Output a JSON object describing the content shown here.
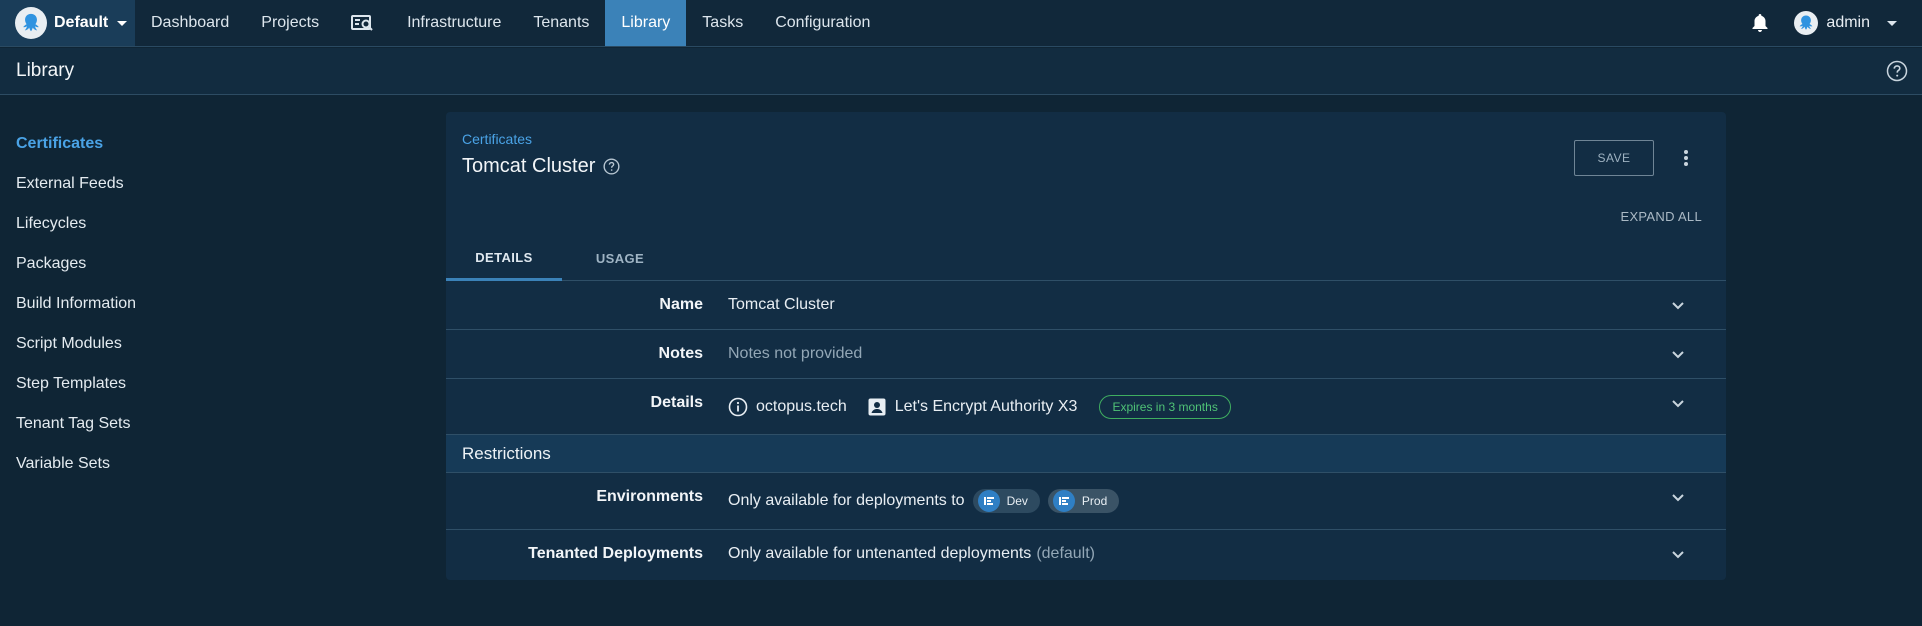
{
  "nav": {
    "space": "Default",
    "items": [
      "Dashboard",
      "Projects",
      "Infrastructure",
      "Tenants",
      "Library",
      "Tasks",
      "Configuration"
    ],
    "active": "Library",
    "user": "admin"
  },
  "page": {
    "title": "Library"
  },
  "sidebar": {
    "items": [
      "Certificates",
      "External Feeds",
      "Lifecycles",
      "Packages",
      "Build Information",
      "Script Modules",
      "Step Templates",
      "Tenant Tag Sets",
      "Variable Sets"
    ],
    "active": "Certificates"
  },
  "card": {
    "breadcrumb": "Certificates",
    "title": "Tomcat Cluster",
    "save_label": "SAVE",
    "expand_all": "EXPAND ALL",
    "tabs": [
      "DETAILS",
      "USAGE"
    ],
    "active_tab": "DETAILS",
    "rows": {
      "name": {
        "label": "Name",
        "value": "Tomcat Cluster"
      },
      "notes": {
        "label": "Notes",
        "value": "Notes not provided"
      },
      "details": {
        "label": "Details",
        "subject": "octopus.tech",
        "issuer": "Let's Encrypt Authority X3",
        "expires": "Expires in 3 months"
      }
    },
    "restrictions": {
      "heading": "Restrictions",
      "environments": {
        "label": "Environments",
        "prefix": "Only available for deployments to",
        "chips": [
          "Dev",
          "Prod"
        ]
      },
      "tenanted": {
        "label": "Tenanted Deployments",
        "value": "Only available for untenanted deployments",
        "suffix": "(default)"
      }
    }
  },
  "colors": {
    "accent": "#3b82b8",
    "link": "#4aa3e6",
    "success": "#3fae60",
    "background": "#0f2535"
  }
}
